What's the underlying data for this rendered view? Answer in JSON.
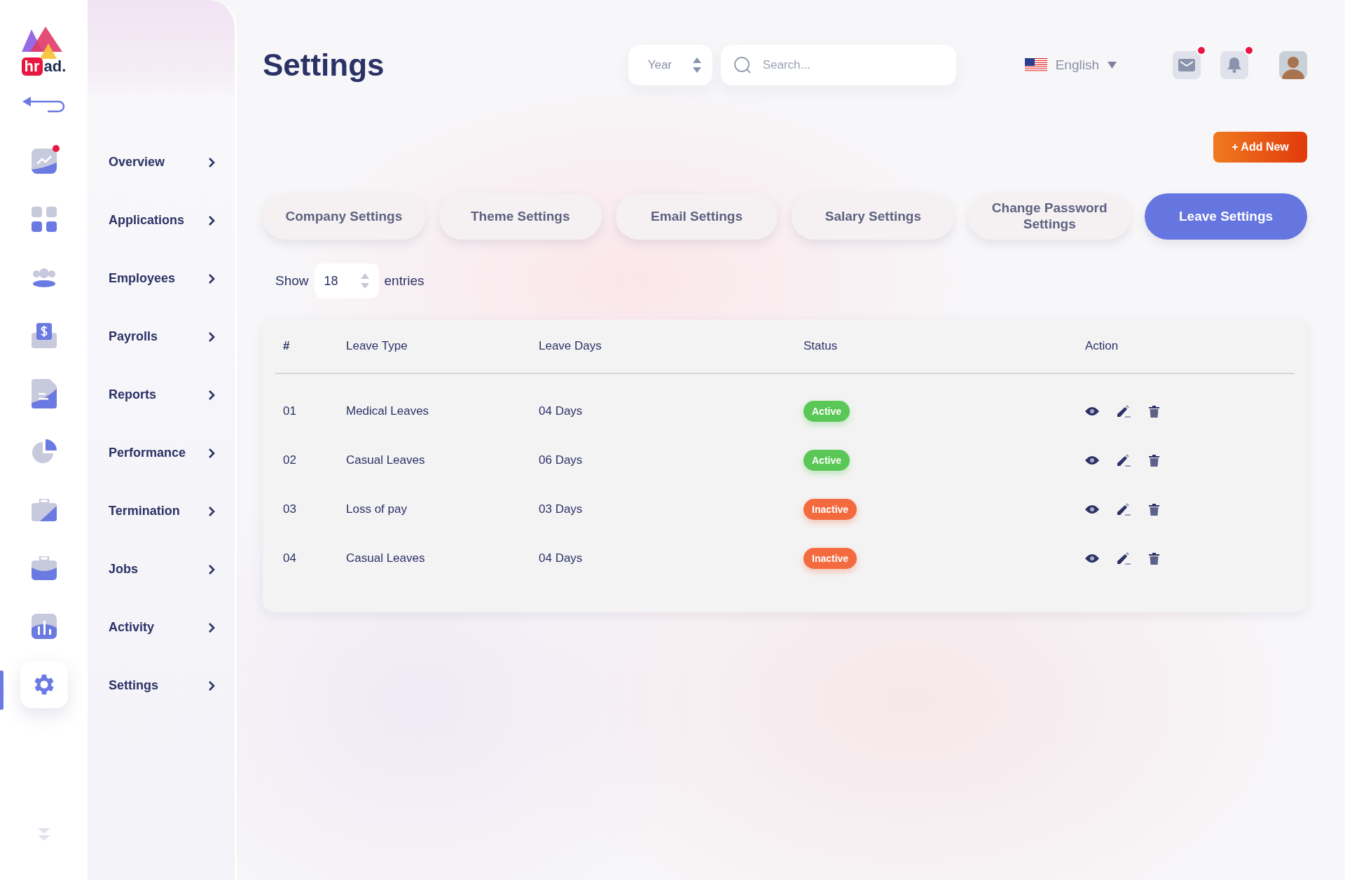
{
  "logo": {
    "badge": "hr",
    "text": "ad."
  },
  "sidebar": {
    "items": [
      {
        "label": "Overview",
        "selected": false,
        "alert": true
      },
      {
        "label": "Applications",
        "selected": false,
        "alert": false
      },
      {
        "label": "Employees",
        "selected": false,
        "alert": false
      },
      {
        "label": "Payrolls",
        "selected": false,
        "alert": false
      },
      {
        "label": "Reports",
        "selected": false,
        "alert": false
      },
      {
        "label": "Performance",
        "selected": false,
        "alert": false
      },
      {
        "label": "Termination",
        "selected": false,
        "alert": false
      },
      {
        "label": "Jobs",
        "selected": false,
        "alert": false
      },
      {
        "label": "Activity",
        "selected": false,
        "alert": false
      },
      {
        "label": "Settings",
        "selected": true,
        "alert": false
      }
    ]
  },
  "page_title": "Settings",
  "header": {
    "year_select": "Year",
    "search": {
      "placeholder": "Search..."
    },
    "language": "English",
    "mail_unread": true,
    "notifications_unread": true
  },
  "add_button": "+ Add New",
  "tabs": [
    {
      "label": "Company Settings",
      "selected": false
    },
    {
      "label": "Theme Settings",
      "selected": false
    },
    {
      "label": "Email Settings",
      "selected": false
    },
    {
      "label": "Salary Settings",
      "selected": false
    },
    {
      "label": "Change Password Settings",
      "selected": false
    },
    {
      "label": "Leave Settings",
      "selected": true
    }
  ],
  "entries": {
    "prefix": "Show",
    "value": "18",
    "suffix": "entries"
  },
  "table": {
    "columns": [
      "#",
      "Leave Type",
      "Leave Days",
      "Status",
      "Action"
    ],
    "rows": [
      {
        "no": "01",
        "type": "Medical Leaves",
        "days": "04 Days",
        "status": "Active",
        "active": true
      },
      {
        "no": "02",
        "type": "Casual Leaves",
        "days": "06 Days",
        "status": "Active",
        "active": true
      },
      {
        "no": "03",
        "type": "Loss of pay",
        "days": "03 Days",
        "status": "Inactive",
        "active": false
      },
      {
        "no": "04",
        "type": "Casual Leaves",
        "days": "04 Days",
        "status": "Inactive",
        "active": false
      }
    ]
  }
}
